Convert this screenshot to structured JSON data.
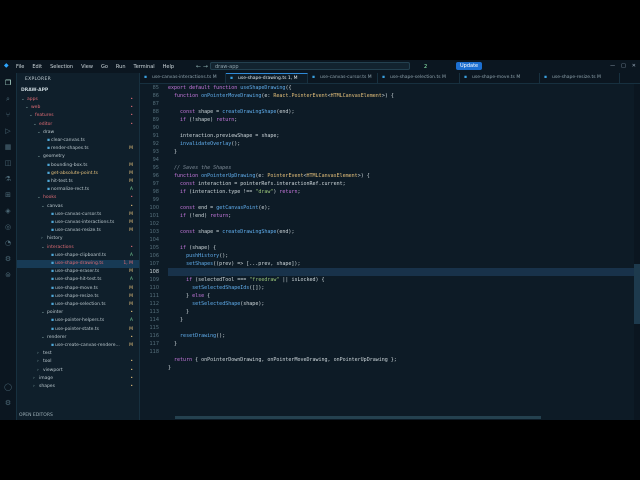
{
  "titlebar": {
    "menu": [
      "File",
      "Edit",
      "Selection",
      "View",
      "Go",
      "Run",
      "Terminal",
      "Help"
    ],
    "nav_arrows": "← →",
    "command_center": "draw-app",
    "counter": "2",
    "update_label": "Update",
    "window_controls": [
      "—",
      "□",
      "✕"
    ]
  },
  "sidebar": {
    "title": "EXPLORER",
    "root": "DRAW-APP",
    "outline": "OPEN EDITORS",
    "tree": [
      {
        "label": "apps",
        "depth": 1,
        "folder": true,
        "open": true,
        "color": "red",
        "badge": "•"
      },
      {
        "label": "web",
        "depth": 2,
        "folder": true,
        "open": true,
        "color": "red",
        "badge": "•"
      },
      {
        "label": "features",
        "depth": 3,
        "folder": true,
        "open": true,
        "color": "red",
        "badge": "•"
      },
      {
        "label": "editor",
        "depth": 4,
        "folder": true,
        "open": true,
        "color": "red",
        "badge": "•"
      },
      {
        "label": "draw",
        "depth": 5,
        "folder": true,
        "open": true,
        "color": "def",
        "badge": ""
      },
      {
        "label": "clear-canvas.ts",
        "depth": 6,
        "folder": false,
        "color": "def",
        "badge": ""
      },
      {
        "label": "render-shapes.ts",
        "depth": 6,
        "folder": false,
        "color": "def",
        "badge": "M"
      },
      {
        "label": "geometry",
        "depth": 5,
        "folder": true,
        "open": true,
        "color": "def",
        "badge": ""
      },
      {
        "label": "bounding-box.ts",
        "depth": 6,
        "folder": false,
        "color": "def",
        "badge": "M"
      },
      {
        "label": "get-absolute-point.ts",
        "depth": 6,
        "folder": false,
        "color": "yel",
        "badge": "M"
      },
      {
        "label": "hit-test.ts",
        "depth": 6,
        "folder": false,
        "color": "def",
        "badge": "M"
      },
      {
        "label": "normalize-rect.ts",
        "depth": 6,
        "folder": false,
        "color": "def",
        "badge": "A"
      },
      {
        "label": "hooks",
        "depth": 5,
        "folder": true,
        "open": true,
        "color": "red",
        "badge": "•"
      },
      {
        "label": "canvas",
        "depth": 6,
        "folder": true,
        "open": true,
        "color": "def",
        "badge": "•"
      },
      {
        "label": "use-canvas-cursor.ts",
        "depth": 7,
        "folder": false,
        "color": "def",
        "badge": "M"
      },
      {
        "label": "use-canvas-interactions.ts",
        "depth": 7,
        "folder": false,
        "color": "def",
        "badge": "M"
      },
      {
        "label": "use-canvas-resize.ts",
        "depth": 7,
        "folder": false,
        "color": "def",
        "badge": "M"
      },
      {
        "label": "history",
        "depth": 6,
        "folder": true,
        "open": false,
        "color": "def",
        "badge": ""
      },
      {
        "label": "interactions",
        "depth": 6,
        "folder": true,
        "open": true,
        "color": "red",
        "badge": "•"
      },
      {
        "label": "use-shape-clipboard.ts",
        "depth": 7,
        "folder": false,
        "color": "def",
        "badge": "A"
      },
      {
        "label": "use-shape-drawing.ts",
        "depth": 7,
        "folder": false,
        "color": "red",
        "badge": "1, M",
        "selected": true
      },
      {
        "label": "use-shape-eraser.ts",
        "depth": 7,
        "folder": false,
        "color": "def",
        "badge": "M"
      },
      {
        "label": "use-shape-hit-test.ts",
        "depth": 7,
        "folder": false,
        "color": "def",
        "badge": "A"
      },
      {
        "label": "use-shape-move.ts",
        "depth": 7,
        "folder": false,
        "color": "def",
        "badge": "M"
      },
      {
        "label": "use-shape-resize.ts",
        "depth": 7,
        "folder": false,
        "color": "def",
        "badge": "M"
      },
      {
        "label": "use-shape-selection.ts",
        "depth": 7,
        "folder": false,
        "color": "def",
        "badge": "M"
      },
      {
        "label": "pointer",
        "depth": 6,
        "folder": true,
        "open": true,
        "color": "def",
        "badge": "•"
      },
      {
        "label": "use-pointer-helpers.ts",
        "depth": 7,
        "folder": false,
        "color": "def",
        "badge": "A"
      },
      {
        "label": "use-pointer-state.ts",
        "depth": 7,
        "folder": false,
        "color": "def",
        "badge": "M"
      },
      {
        "label": "renderer",
        "depth": 6,
        "folder": true,
        "open": true,
        "color": "def",
        "badge": "•"
      },
      {
        "label": "use-create-canvas-rendere...",
        "depth": 7,
        "folder": false,
        "color": "def",
        "badge": "M"
      },
      {
        "label": "test",
        "depth": 5,
        "folder": true,
        "open": false,
        "color": "def",
        "badge": ""
      },
      {
        "label": "tool",
        "depth": 5,
        "folder": true,
        "open": false,
        "color": "def",
        "badge": "•"
      },
      {
        "label": "viewport",
        "depth": 5,
        "folder": true,
        "open": false,
        "color": "def",
        "badge": "•"
      },
      {
        "label": "image",
        "depth": 4,
        "folder": true,
        "open": false,
        "color": "def",
        "badge": "•"
      },
      {
        "label": "shapes",
        "depth": 4,
        "folder": true,
        "open": false,
        "color": "def",
        "badge": "•"
      }
    ]
  },
  "tabs": [
    {
      "label": "use-canvas-interactions.ts M",
      "active": false
    },
    {
      "label": "use-shape-drawing.ts 1, M",
      "active": true
    },
    {
      "label": "use-canvas-cursor.ts M",
      "active": false
    },
    {
      "label": "use-shape-selection.ts M",
      "active": false
    },
    {
      "label": "use-shape-move.ts M",
      "active": false
    },
    {
      "label": "use-shape-resize.ts M",
      "active": false
    }
  ],
  "editor": {
    "line_numbers": [
      "85",
      "86",
      "87",
      "88",
      "89",
      "90",
      "91",
      "92",
      "93",
      "94",
      "95",
      "96",
      "97",
      "98",
      "99",
      "100",
      "101",
      "102",
      "103",
      "104",
      "105",
      "106",
      "107",
      "108",
      "109",
      "110",
      "111",
      "112",
      "113",
      "114",
      "115",
      "116",
      "117",
      "118"
    ],
    "current_line": "108",
    "lines": [
      "export default function useShapeDrawing({",
      "  function onPointerMoveDrawing(e: React.PointerEvent<HTMLCanvasElement>) {",
      "",
      "    const shape = createDrawingShape(end);",
      "    if (!shape) return;",
      "",
      "    interaction.previewShape = shape;",
      "    invalidateOverlay();",
      "  }",
      "",
      "  // Saves the Shapes",
      "  function onPointerUpDrawing(e: PointerEvent<HTMLCanvasElement>) {",
      "    const interaction = pointerRefs.interactionRef.current;",
      "    if (interaction.type !== \"draw\") return;",
      "",
      "    const end = getCanvasPoint(e);",
      "    if (!end) return;",
      "",
      "    const shape = createDrawingShape(end);",
      "",
      "    if (shape) {",
      "      pushHistory();",
      "      setShapes((prev) => [...prev, shape]);",
      "",
      "      if (selectedTool === \"freedraw\" || isLocked) {",
      "        setSelectedShapeIds([]);",
      "      } else {",
      "        setSelectedShape(shape);",
      "      }",
      "    }",
      "",
      "    resetDrawing();",
      "  }",
      "",
      "  return { onPointerDownDrawing, onPointerMoveDrawing, onPointerUpDrawing };",
      "}"
    ]
  },
  "colors": {
    "accent": "#2f8ad8",
    "background": "#0d1b26",
    "modified": "#e5c07b",
    "error": "#e06c75"
  }
}
